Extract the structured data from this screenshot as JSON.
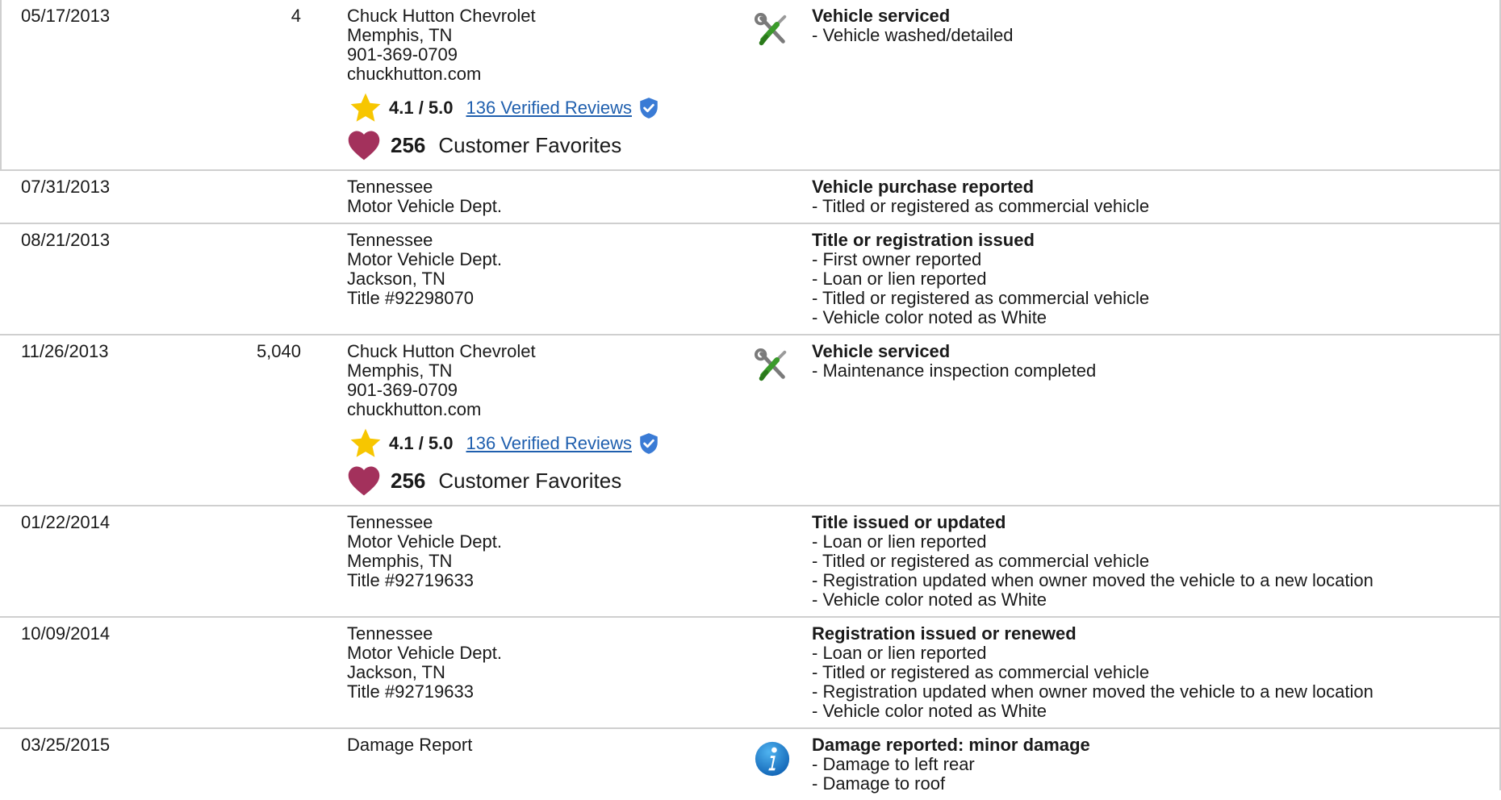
{
  "rows": [
    {
      "date": "05/17/2013",
      "odometer": "4",
      "source": [
        "Chuck Hutton Chevrolet",
        "Memphis, TN",
        "901-369-0709",
        "chuckhutton.com"
      ],
      "rating": "4.1 / 5.0",
      "reviews": "136 Verified Reviews",
      "favorites_count": "256",
      "favorites_label": "Customer Favorites",
      "icon": "wrench-screwdriver-icon",
      "title": "Vehicle serviced",
      "details": [
        "- Vehicle washed/detailed"
      ]
    },
    {
      "date": "07/31/2013",
      "odometer": "",
      "source": [
        "Tennessee",
        "Motor Vehicle Dept."
      ],
      "title": "Vehicle purchase reported",
      "details": [
        "- Titled or registered as commercial vehicle"
      ]
    },
    {
      "date": "08/21/2013",
      "odometer": "",
      "source": [
        "Tennessee",
        "Motor Vehicle Dept.",
        "Jackson, TN",
        "Title #92298070"
      ],
      "title": "Title or registration issued",
      "details": [
        "- First owner reported",
        "- Loan or lien reported",
        "- Titled or registered as commercial vehicle",
        "- Vehicle color noted as White"
      ]
    },
    {
      "date": "11/26/2013",
      "odometer": "5,040",
      "source": [
        "Chuck Hutton Chevrolet",
        "Memphis, TN",
        "901-369-0709",
        "chuckhutton.com"
      ],
      "rating": "4.1 / 5.0",
      "reviews": "136 Verified Reviews",
      "favorites_count": "256",
      "favorites_label": "Customer Favorites",
      "icon": "wrench-screwdriver-icon",
      "title": "Vehicle serviced",
      "details": [
        "- Maintenance inspection completed"
      ]
    },
    {
      "date": "01/22/2014",
      "odometer": "",
      "source": [
        "Tennessee",
        "Motor Vehicle Dept.",
        "Memphis, TN",
        "Title #92719633"
      ],
      "title": "Title issued or updated",
      "details": [
        "- Loan or lien reported",
        "- Titled or registered as commercial vehicle",
        "- Registration updated when owner moved the vehicle to a new location",
        "- Vehicle color noted as White"
      ]
    },
    {
      "date": "10/09/2014",
      "odometer": "",
      "source": [
        "Tennessee",
        "Motor Vehicle Dept.",
        "Jackson, TN",
        "Title #92719633"
      ],
      "title": "Registration issued or renewed",
      "details": [
        "- Loan or lien reported",
        "- Titled or registered as commercial vehicle",
        "- Registration updated when owner moved the vehicle to a new location",
        "- Vehicle color noted as White"
      ]
    },
    {
      "date": "03/25/2015",
      "odometer": "",
      "source": [
        "Damage Report"
      ],
      "icon": "info-icon",
      "title": "Damage reported: minor damage",
      "details": [
        "- Damage to left rear",
        "- Damage to roof"
      ]
    }
  ],
  "colors": {
    "star": "#f7c600",
    "heart": "#a3315c",
    "link": "#1f5fae",
    "verified": "#3a7bd5",
    "info": "#1e88d0",
    "border": "#cfcfcf"
  }
}
